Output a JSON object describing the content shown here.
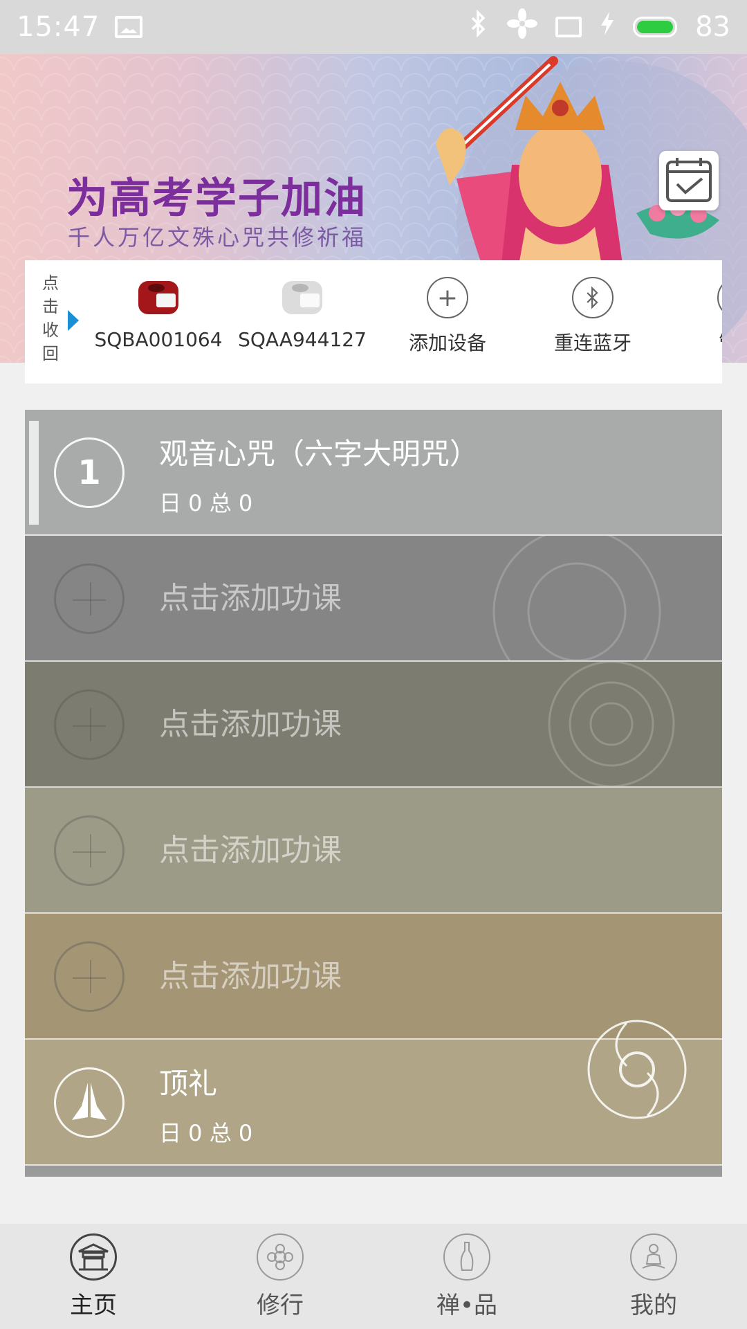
{
  "status_bar": {
    "time": "15:47",
    "battery": "83"
  },
  "banner": {
    "headline": "为高考学子加油",
    "subline": "千人万亿文殊心咒共修祈福"
  },
  "device_bar": {
    "collapse_label": "点击收回",
    "devices": [
      {
        "label": "SQBA001064",
        "icon": "red-counter-device-icon"
      },
      {
        "label": "SQAA944127",
        "icon": "grey-counter-device-icon"
      },
      {
        "label": "添加设备",
        "icon": "plus-circle-icon"
      },
      {
        "label": "重连蓝牙",
        "icon": "bluetooth-icon"
      },
      {
        "label": "管理",
        "icon": "manage-icon"
      }
    ]
  },
  "practices": [
    {
      "number": "1",
      "title": "观音心咒（六字大明咒）",
      "stats": "日 0 总 0",
      "color": "#a9abab"
    },
    {
      "add_label": "点击添加功课",
      "color": "#858585"
    },
    {
      "add_label": "点击添加功课",
      "color": "#7d7c70"
    },
    {
      "add_label": "点击添加功课",
      "color": "#9c9b87"
    },
    {
      "add_label": "点击添加功课",
      "color": "#a49675"
    },
    {
      "title": "顶礼",
      "stats": "日 0 总 0",
      "color": "#b0a587",
      "icon": "praying-hands-icon"
    }
  ],
  "bottom_nav": [
    {
      "label": "主页",
      "icon": "temple-icon"
    },
    {
      "label": "修行",
      "icon": "lotus-icon"
    },
    {
      "label": "禅•品",
      "icon": "vase-icon"
    },
    {
      "label": "我的",
      "icon": "meditation-person-icon"
    }
  ]
}
